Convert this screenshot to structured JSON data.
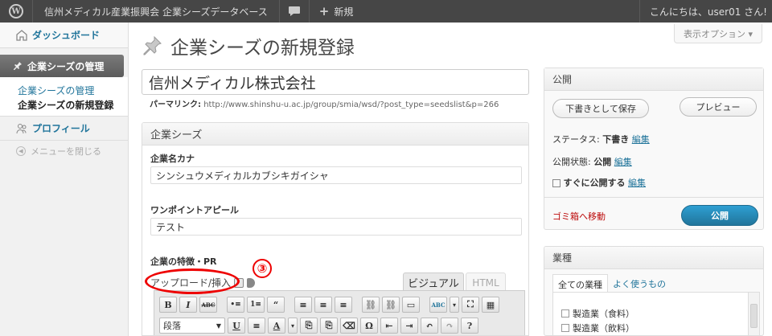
{
  "admin_bar": {
    "wp_logo": "W",
    "site_name": "信州メディカル産業振興会 企業シーズデータベース",
    "comment_icon": "speech-bubble-icon",
    "new_label": "新規",
    "greeting": "こんにちは、user01 さん!"
  },
  "sidebar": {
    "dashboard": "ダッシュボード",
    "seeds_menu": "企業シーズの管理",
    "sub_items": [
      "企業シーズの管理",
      "企業シーズの新規登録"
    ],
    "profile": "プロフィール",
    "collapse": "メニューを閉じる"
  },
  "screen_options": "表示オプション ▾",
  "page_title": "企業シーズの新規登録",
  "post_title": "信州メディカル株式会社",
  "permalink": {
    "label": "パーマリンク:",
    "url": "http://www.shinshu-u.ac.jp/group/smia/wsd/?post_type=seedslist&p=266"
  },
  "seeds_box": {
    "heading": "企業シーズ",
    "kana_label": "企業名カナ",
    "kana_value": "シンシュウメディカルカブシキガイシャ",
    "appeal_label": "ワンポイントアピール",
    "appeal_value": "テスト",
    "pr_label": "企業の特徴・PR",
    "upload_label": "アップロード/挿入",
    "tab_visual": "ビジュアル",
    "tab_html": "HTML",
    "format_select": "段落",
    "annotation_number": "③"
  },
  "toolbar": {
    "row1": [
      "B",
      "I",
      "ABC",
      "•≡",
      "1≡",
      "“",
      "≡",
      "≡",
      "≡",
      "⛓",
      "⛓",
      "▭",
      "ABC",
      "▾",
      "⛶",
      "▦"
    ],
    "row2": [
      "U",
      "≡",
      "A",
      "▾",
      "⎘",
      "⎘",
      "⌫",
      "Ω",
      "⇤",
      "⇥",
      "↶",
      "↷",
      "?"
    ]
  },
  "publish_box": {
    "heading": "公開",
    "save_draft": "下書きとして保存",
    "preview": "プレビュー",
    "status_label": "ステータス:",
    "status_value": "下書き",
    "edit1": "編集",
    "visibility_label": "公開状態:",
    "visibility_value": "公開",
    "edit2": "編集",
    "schedule_value": "すぐに公開する",
    "edit3": "編集",
    "trash": "ゴミ箱へ移動",
    "publish": "公開"
  },
  "industry_box": {
    "heading": "業種",
    "tab_all": "全ての業種",
    "tab_popular": "よく使うもの",
    "items": [
      "製造業（食料）",
      "製造業（飲料）"
    ]
  }
}
